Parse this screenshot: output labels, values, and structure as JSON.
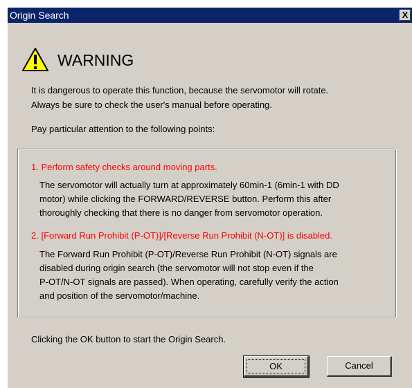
{
  "window": {
    "title": "Origin Search",
    "close_label": "X"
  },
  "warning": {
    "title": "WARNING",
    "intro_lines": [
      "It is dangerous to operate this function, because the servomotor will rotate.",
      "Always be sure to check the user's manual before operating."
    ],
    "attention": "Pay particular attention to the following points:"
  },
  "points": [
    {
      "heading": "1. Perform safety checks around moving parts.",
      "lines": [
        "The servomotor will actually turn at approximately 60min-1 (6min-1 with DD",
        "motor) while clicking the FORWARD/REVERSE button. Perform this after",
        "thoroughly checking that there is no danger from servomotor operation."
      ]
    },
    {
      "heading": "2. [Forward Run Prohibit (P-OT)]/[Reverse Run Prohibit (N-OT)] is disabled.",
      "lines": [
        "The Forward Run Prohibit (P-OT)/Reverse Run Prohibit (N-OT) signals are",
        "disabled during origin search (the servomotor will not stop even if the",
        "P-OT/N-OT signals are passed). When operating, carefully verify the action",
        "and position of the servomotor/machine."
      ]
    }
  ],
  "footer_text": "Clicking the OK button to start the Origin Search.",
  "buttons": {
    "ok": "OK",
    "cancel": "Cancel"
  },
  "colors": {
    "titlebar": "#0a246a",
    "dialog_bg": "#d4d0c8",
    "heading_red": "#ff0000",
    "icon_yellow": "#ffff00"
  },
  "icons": {
    "warning": "warning-triangle-icon",
    "close": "close-icon"
  }
}
